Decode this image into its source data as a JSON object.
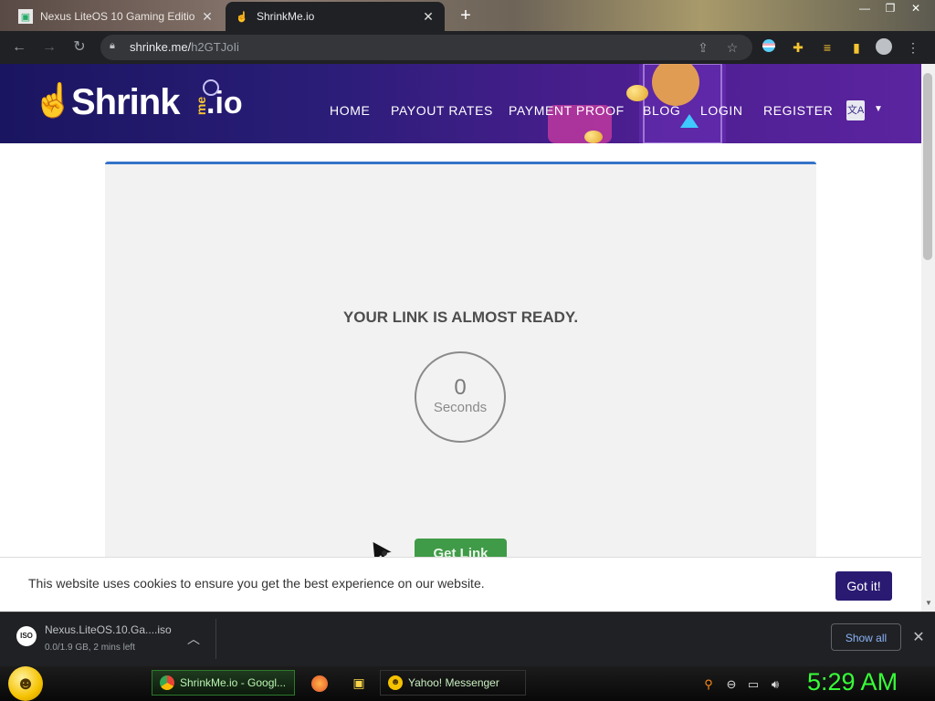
{
  "browser": {
    "tabs": [
      {
        "title": "Nexus LiteOS 10 Gaming Editio",
        "favicon": "liteos-icon",
        "close": "✕"
      },
      {
        "title": "ShrinkMe.io",
        "favicon": "shrinkme-hand-icon",
        "close": "✕"
      }
    ],
    "new_tab": "+",
    "address": {
      "domain": "shrinke.me/",
      "path": "h2GTJoIi"
    }
  },
  "site": {
    "logo": {
      "text": "Shrink",
      "me": "me",
      "io": ".io"
    },
    "nav": [
      "HOME",
      "PAYOUT RATES",
      "PAYMENT PROOF",
      "BLOG",
      "LOGIN",
      "REGISTER"
    ],
    "lang_icon": "文A"
  },
  "main": {
    "headline": "YOUR LINK IS ALMOST READY.",
    "timer_value": "0",
    "timer_unit": "Seconds",
    "get_link": "Get Link"
  },
  "cookie": {
    "text": "This website uses cookies to ensure you get the best experience on our website.",
    "button": "Got it!"
  },
  "download": {
    "name": "Nexus.LiteOS.10.Ga....iso",
    "status": "0.0/1.9 GB, 2 mins left",
    "icon_label": "ISO",
    "show_all": "Show all"
  },
  "taskbar": {
    "tasks": [
      "ShrinkMe.io - Googl...",
      "Yahoo! Messenger"
    ],
    "clock": "5:29 AM"
  },
  "colors": {
    "header_purple": "#2a1d78",
    "card_accent": "#3473c8",
    "get_link_green": "#3f9b47",
    "got_it_purple": "#2a1a72",
    "clock_green": "#37ff37"
  }
}
